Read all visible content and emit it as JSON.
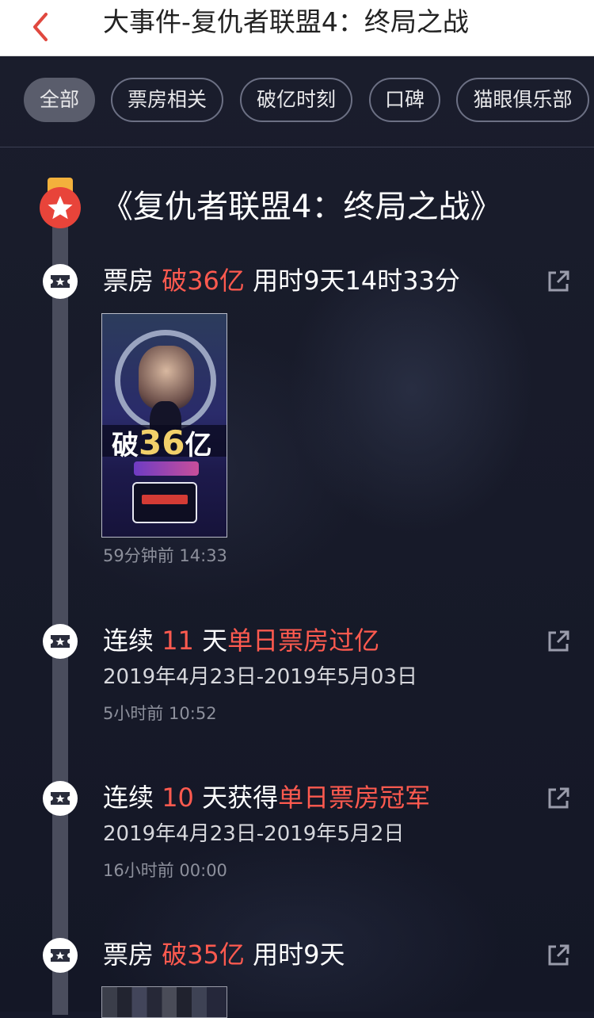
{
  "header": {
    "title": "大事件-复仇者联盟4：终局之战"
  },
  "tabs": [
    {
      "label": "全部",
      "active": true
    },
    {
      "label": "票房相关",
      "active": false
    },
    {
      "label": "破亿时刻",
      "active": false
    },
    {
      "label": "口碑",
      "active": false
    },
    {
      "label": "猫眼俱乐部",
      "active": false
    }
  ],
  "movie": {
    "title": "《复仇者联盟4：终局之战》"
  },
  "events": [
    {
      "pre": "票房 ",
      "highlight": "破36亿",
      "post": " 用时9天14时33分",
      "sub": "",
      "time": "59分钟前 14:33",
      "poster": {
        "big_prefix": "破",
        "big_number": "36",
        "big_suffix": "亿"
      }
    },
    {
      "pre": "连续 ",
      "highlight": "11",
      "post": " 天",
      "highlight2": "单日票房过亿",
      "sub": "2019年4月23日-2019年5月03日",
      "time": "5小时前 10:52"
    },
    {
      "pre": "连续 ",
      "highlight": "10",
      "post": " 天获得",
      "highlight2": "单日票房冠军",
      "sub": "2019年4月23日-2019年5月2日",
      "time": "16小时前 00:00"
    },
    {
      "pre": "票房 ",
      "highlight": "破35亿",
      "post": " 用时9天",
      "sub": "",
      "time": ""
    }
  ],
  "colors": {
    "accent": "#ff5a4f",
    "badge": "#e8443a",
    "background": "#16192a"
  },
  "icons": [
    "back-arrow-icon",
    "star-icon",
    "ticket-icon",
    "share-icon"
  ]
}
